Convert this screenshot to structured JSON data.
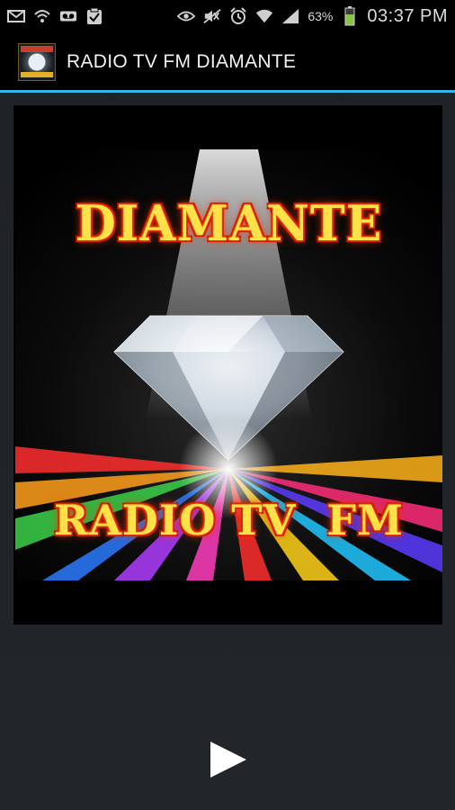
{
  "status_bar": {
    "left_icons": [
      "mail-icon",
      "wifi-icon",
      "voicemail-icon",
      "clipboard-check-icon"
    ],
    "right_icons": [
      "eye-icon",
      "no-sound-icon",
      "alarm-icon",
      "wifi-signal-icon",
      "cell-signal-icon"
    ],
    "battery_percent": "63%",
    "battery_icon": "battery-icon",
    "time": "03:37 PM"
  },
  "app_bar": {
    "title": "RADIO TV FM DIAMANTE",
    "logo_icon": "station-logo-icon",
    "divider_color": "#33b5e5"
  },
  "cover_art": {
    "title": "DIAMANTE",
    "subtitle": "RADIO TV  FM",
    "image": "diamond-image"
  },
  "controls": {
    "play_icon": "play-icon"
  }
}
